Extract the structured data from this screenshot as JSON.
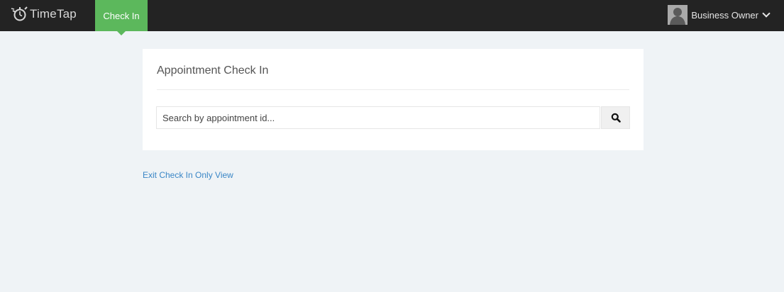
{
  "header": {
    "brand": "TimeTap",
    "active_tab": "Check In",
    "user_label": "Business Owner"
  },
  "card": {
    "title": "Appointment Check In",
    "search_placeholder": "Search by appointment id..."
  },
  "footer_link": "Exit Check In Only View",
  "icons": {
    "logo": "timetap-clock-icon",
    "search": "search-icon",
    "user": "user-avatar",
    "dropdown": "chevron-down-icon"
  },
  "colors": {
    "topbar": "#232323",
    "accent": "#5cb85c",
    "background": "#eff3f6",
    "link": "#3a86c6"
  }
}
